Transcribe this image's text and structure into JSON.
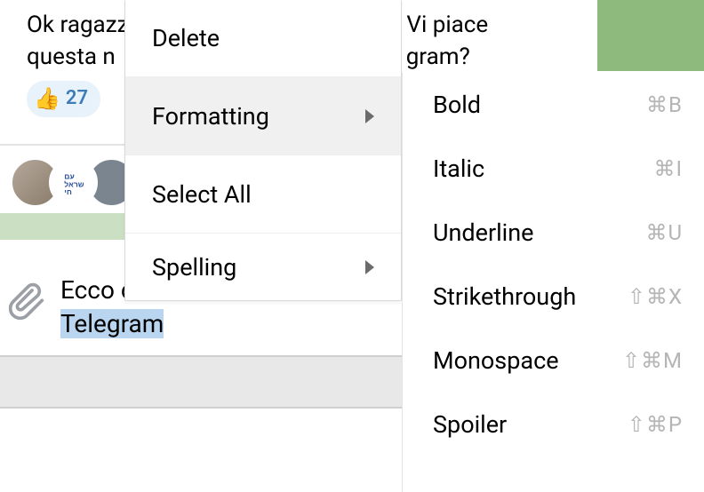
{
  "chat": {
    "line1_left": "Ok ragazz",
    "line1_right": "Vi piace",
    "line2_left": "questa n",
    "line2_right": "gram?",
    "reaction_emoji": "👍",
    "reaction_count": "27"
  },
  "input": {
    "line1": "Ecco c",
    "line2a": "Telegr",
    "line2b": "am"
  },
  "menu": {
    "delete": "Delete",
    "formatting": "Formatting",
    "selectAll": "Select All",
    "spelling": "Spelling"
  },
  "submenu": {
    "items": [
      {
        "label": "Bold",
        "shortcut": "⌘B"
      },
      {
        "label": "Italic",
        "shortcut": "⌘I"
      },
      {
        "label": "Underline",
        "shortcut": "⌘U"
      },
      {
        "label": "Strikethrough",
        "shortcut": "⇧⌘X"
      },
      {
        "label": "Monospace",
        "shortcut": "⇧⌘M"
      },
      {
        "label": "Spoiler",
        "shortcut": "⇧⌘P"
      }
    ]
  }
}
